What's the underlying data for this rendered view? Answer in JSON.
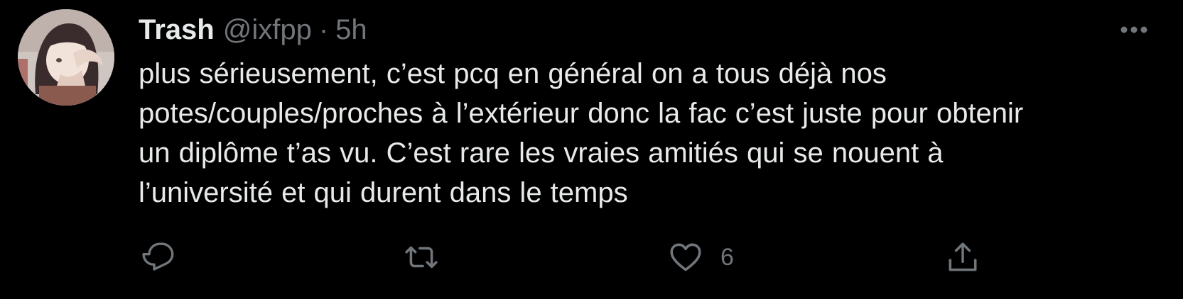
{
  "tweet": {
    "author": {
      "display_name": "Trash",
      "handle": "@ixfpp"
    },
    "separator": "·",
    "time": "5h",
    "text_lines": [
      "plus sérieusement, c’est pcq en général on a tous déjà nos",
      "potes/couples/proches à l’extérieur donc la fac c’est juste pour obtenir",
      "un diplôme t’as vu. C’est rare les vraies amitiés qui se nouent à",
      "l’université et qui durent dans le temps"
    ],
    "actions": {
      "like_count": "6"
    },
    "icons": {
      "more": "more-dots-icon",
      "reply": "reply-icon",
      "retweet": "retweet-icon",
      "like": "heart-icon",
      "share": "share-icon"
    }
  },
  "colors": {
    "background": "#000000",
    "text_primary": "#e7e9ea",
    "text_secondary": "#71767b"
  }
}
